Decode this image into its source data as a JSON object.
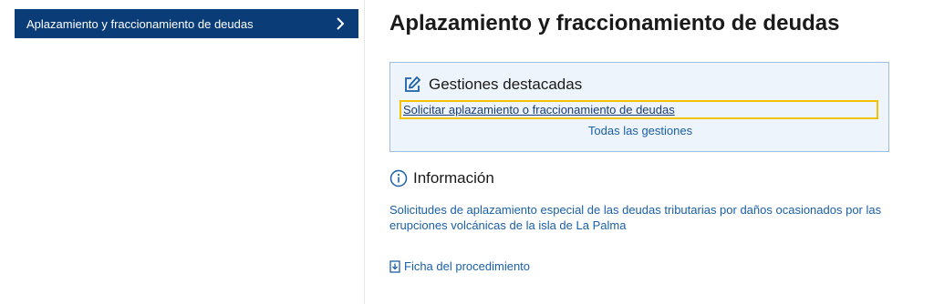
{
  "sidebar": {
    "items": [
      {
        "label": "Aplazamiento y fraccionamiento de deudas",
        "icon": "chevron-right-icon"
      }
    ]
  },
  "main": {
    "title": "Aplazamiento y fraccionamiento de deudas",
    "featured": {
      "icon": "edit-icon",
      "title": "Gestiones destacadas",
      "primary_link": "Solicitar aplazamiento o fraccionamiento de deudas",
      "all_link": "Todas las gestiones"
    },
    "info": {
      "icon": "info-icon",
      "title": "Información",
      "link_text": "Solicitudes de aplazamiento especial de las deudas tributarias por daños ocasionados por las erupciones volcánicas de la isla de La Palma"
    },
    "ficha": {
      "icon": "document-icon",
      "label": "Ficha del procedimiento"
    }
  },
  "colors": {
    "sidebar_active_bg": "#0a3d78",
    "link": "#1a5fa8",
    "highlight_bg": "#eef4fb",
    "highlight_border": "#9fbfdf",
    "focus_outline": "#f2c200"
  }
}
